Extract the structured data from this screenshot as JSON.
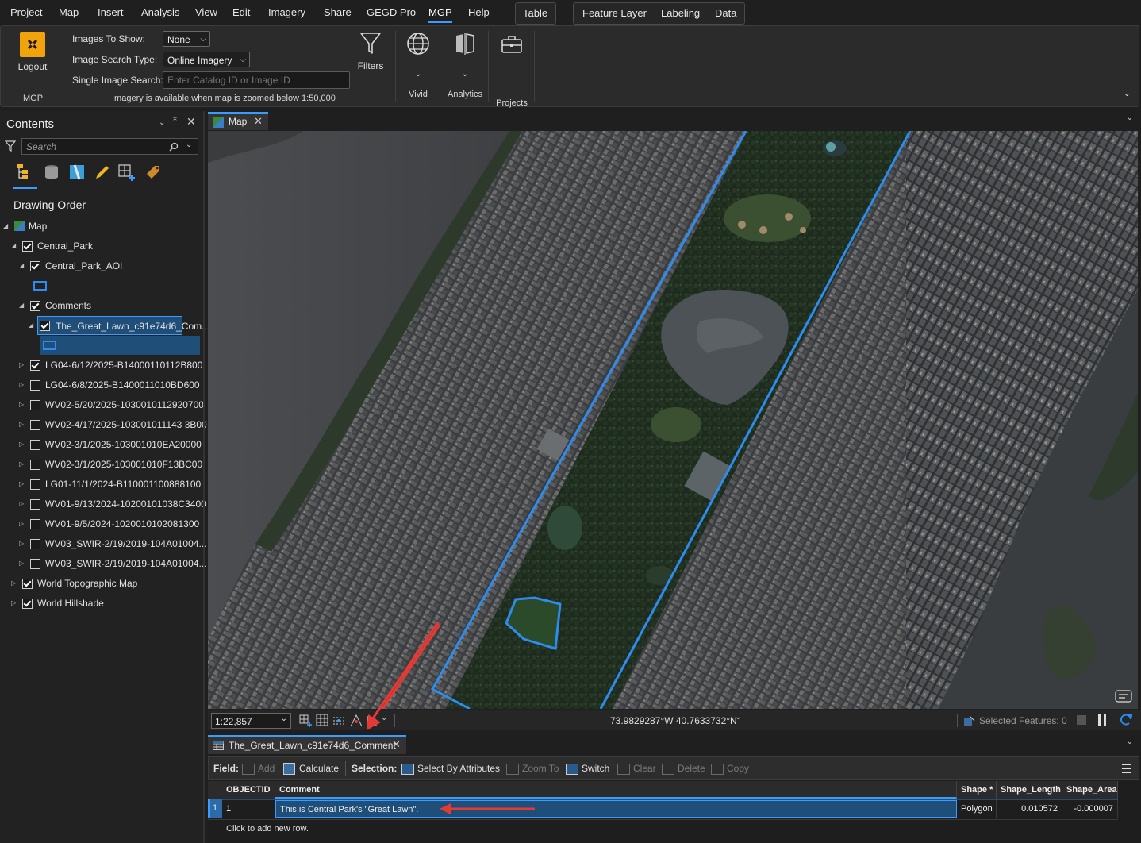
{
  "menubar": {
    "items": [
      "Project",
      "Map",
      "Insert",
      "Analysis",
      "View",
      "Edit",
      "Imagery",
      "Share",
      "GEGD Pro",
      "MGP",
      "Help"
    ],
    "active": "MGP",
    "context_tabs": [
      "Table",
      "Feature Layer",
      "Labeling",
      "Data"
    ]
  },
  "ribbon": {
    "logout_label": "Logout",
    "mgp_group": "MGP",
    "images_to_show_label": "Images To Show:",
    "images_to_show_value": "None",
    "image_search_type_label": "Image Search Type:",
    "image_search_type_value": "Online Imagery",
    "single_image_search_label": "Single Image Search:",
    "single_image_search_placeholder": "Enter Catalog ID or Image ID",
    "note": "Imagery is available when map is zoomed below 1:50,000",
    "filters_label": "Filters",
    "vivid_label": "Vivid",
    "analytics_label": "Analytics",
    "projects_label": "Projects"
  },
  "contents": {
    "title": "Contents",
    "search_placeholder": "Search",
    "drawing_order": "Drawing Order",
    "tree": [
      {
        "label": "Map",
        "level": 0,
        "type": "map"
      },
      {
        "label": "Central_Park",
        "level": 1,
        "checked": true,
        "expanded": true
      },
      {
        "label": "Central_Park_AOI",
        "level": 2,
        "checked": true,
        "expanded": true
      },
      {
        "label": "Comments",
        "level": 2,
        "checked": true,
        "expanded": true
      },
      {
        "label": "The_Great_Lawn_c91e74d6_Com...",
        "level": 3,
        "checked": true,
        "expanded": true,
        "selected": true
      },
      {
        "label": "LG04-6/12/2025-B14000110112B800",
        "level": 2,
        "checked": true
      },
      {
        "label": "LG04-6/8/2025-B1400011010BD600",
        "level": 2,
        "checked": false
      },
      {
        "label": "WV02-5/20/2025-1030010112920700",
        "level": 2,
        "checked": false
      },
      {
        "label": "WV02-4/17/2025-103001011143 3B00",
        "level": 2,
        "checked": false
      },
      {
        "label": "WV02-3/1/2025-103001010EA20000",
        "level": 2,
        "checked": false
      },
      {
        "label": "WV02-3/1/2025-103001010F13BC00",
        "level": 2,
        "checked": false
      },
      {
        "label": "LG01-11/1/2024-B110001100888100",
        "level": 2,
        "checked": false
      },
      {
        "label": "WV01-9/13/2024-10200101038C3400",
        "level": 2,
        "checked": false
      },
      {
        "label": "WV01-9/5/2024-1020010102081300",
        "level": 2,
        "checked": false
      },
      {
        "label": "WV03_SWIR-2/19/2019-104A01004...",
        "level": 2,
        "checked": false
      },
      {
        "label": "WV03_SWIR-2/19/2019-104A01004...",
        "level": 2,
        "checked": false
      },
      {
        "label": "World Topographic Map",
        "level": 1,
        "checked": true
      },
      {
        "label": "World Hillshade",
        "level": 1,
        "checked": true
      }
    ]
  },
  "map": {
    "tab_label": "Map",
    "scale": "1:22,857",
    "coordinates": "73.9829287°W 40.7633732°N",
    "selected_features": "Selected Features: 0"
  },
  "table": {
    "tab_label": "The_Great_Lawn_c91e74d6_Comment",
    "toolbar": {
      "field_label": "Field:",
      "add": "Add",
      "calculate": "Calculate",
      "selection_label": "Selection:",
      "select_by_attributes": "Select By Attributes",
      "zoom_to": "Zoom To",
      "switch": "Switch",
      "clear": "Clear",
      "delete": "Delete",
      "copy": "Copy"
    },
    "columns": [
      "OBJECTID *",
      "Comment",
      "Shape *",
      "Shape_Length",
      "Shape_Area"
    ],
    "rows": [
      {
        "row_num": "1",
        "objectid": "1",
        "comment": "This is Central Park's \"Great Lawn\".",
        "shape": "Polygon",
        "shape_length": "0.010572",
        "shape_area": "-0.000007"
      }
    ],
    "add_row_text": "Click to add new row."
  },
  "colors": {
    "accent": "#3b9cff",
    "aoi_outline": "#2d8cf0",
    "annotation_arrow": "#e53935",
    "selection": "#1f4e79"
  }
}
